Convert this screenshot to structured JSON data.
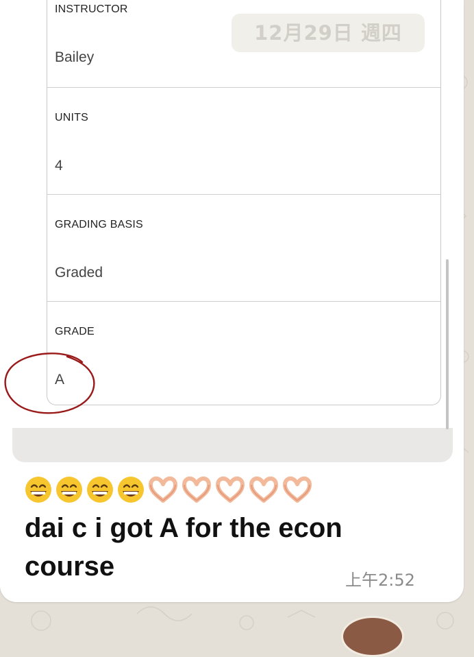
{
  "colors": {
    "chat_background": "#e4e0d8",
    "bubble": "#ffffff",
    "annotation_circle": "#9a1a1a",
    "timestamp": "#8a8a8a"
  },
  "chat": {
    "date_divider": "12月29日 週四"
  },
  "transcript_card": {
    "rows": [
      {
        "label": "INSTRUCTOR",
        "value": "Bailey"
      },
      {
        "label": "UNITS",
        "value": "4"
      },
      {
        "label": "GRADING BASIS",
        "value": "Graded"
      },
      {
        "label": "GRADE",
        "value": "A"
      }
    ]
  },
  "message": {
    "emoji": [
      "grinning-face-with-smiling-eyes",
      "grinning-face-with-smiling-eyes",
      "grinning-face-with-smiling-eyes",
      "grinning-face-with-smiling-eyes",
      "heart-hands",
      "heart-hands",
      "heart-hands",
      "heart-hands",
      "heart-hands"
    ],
    "text": "dai c i got A for the econ course",
    "time": "上午2:52"
  },
  "icons": {
    "annotation": "hand-drawn-circle-icon",
    "avatar": "avatar"
  }
}
